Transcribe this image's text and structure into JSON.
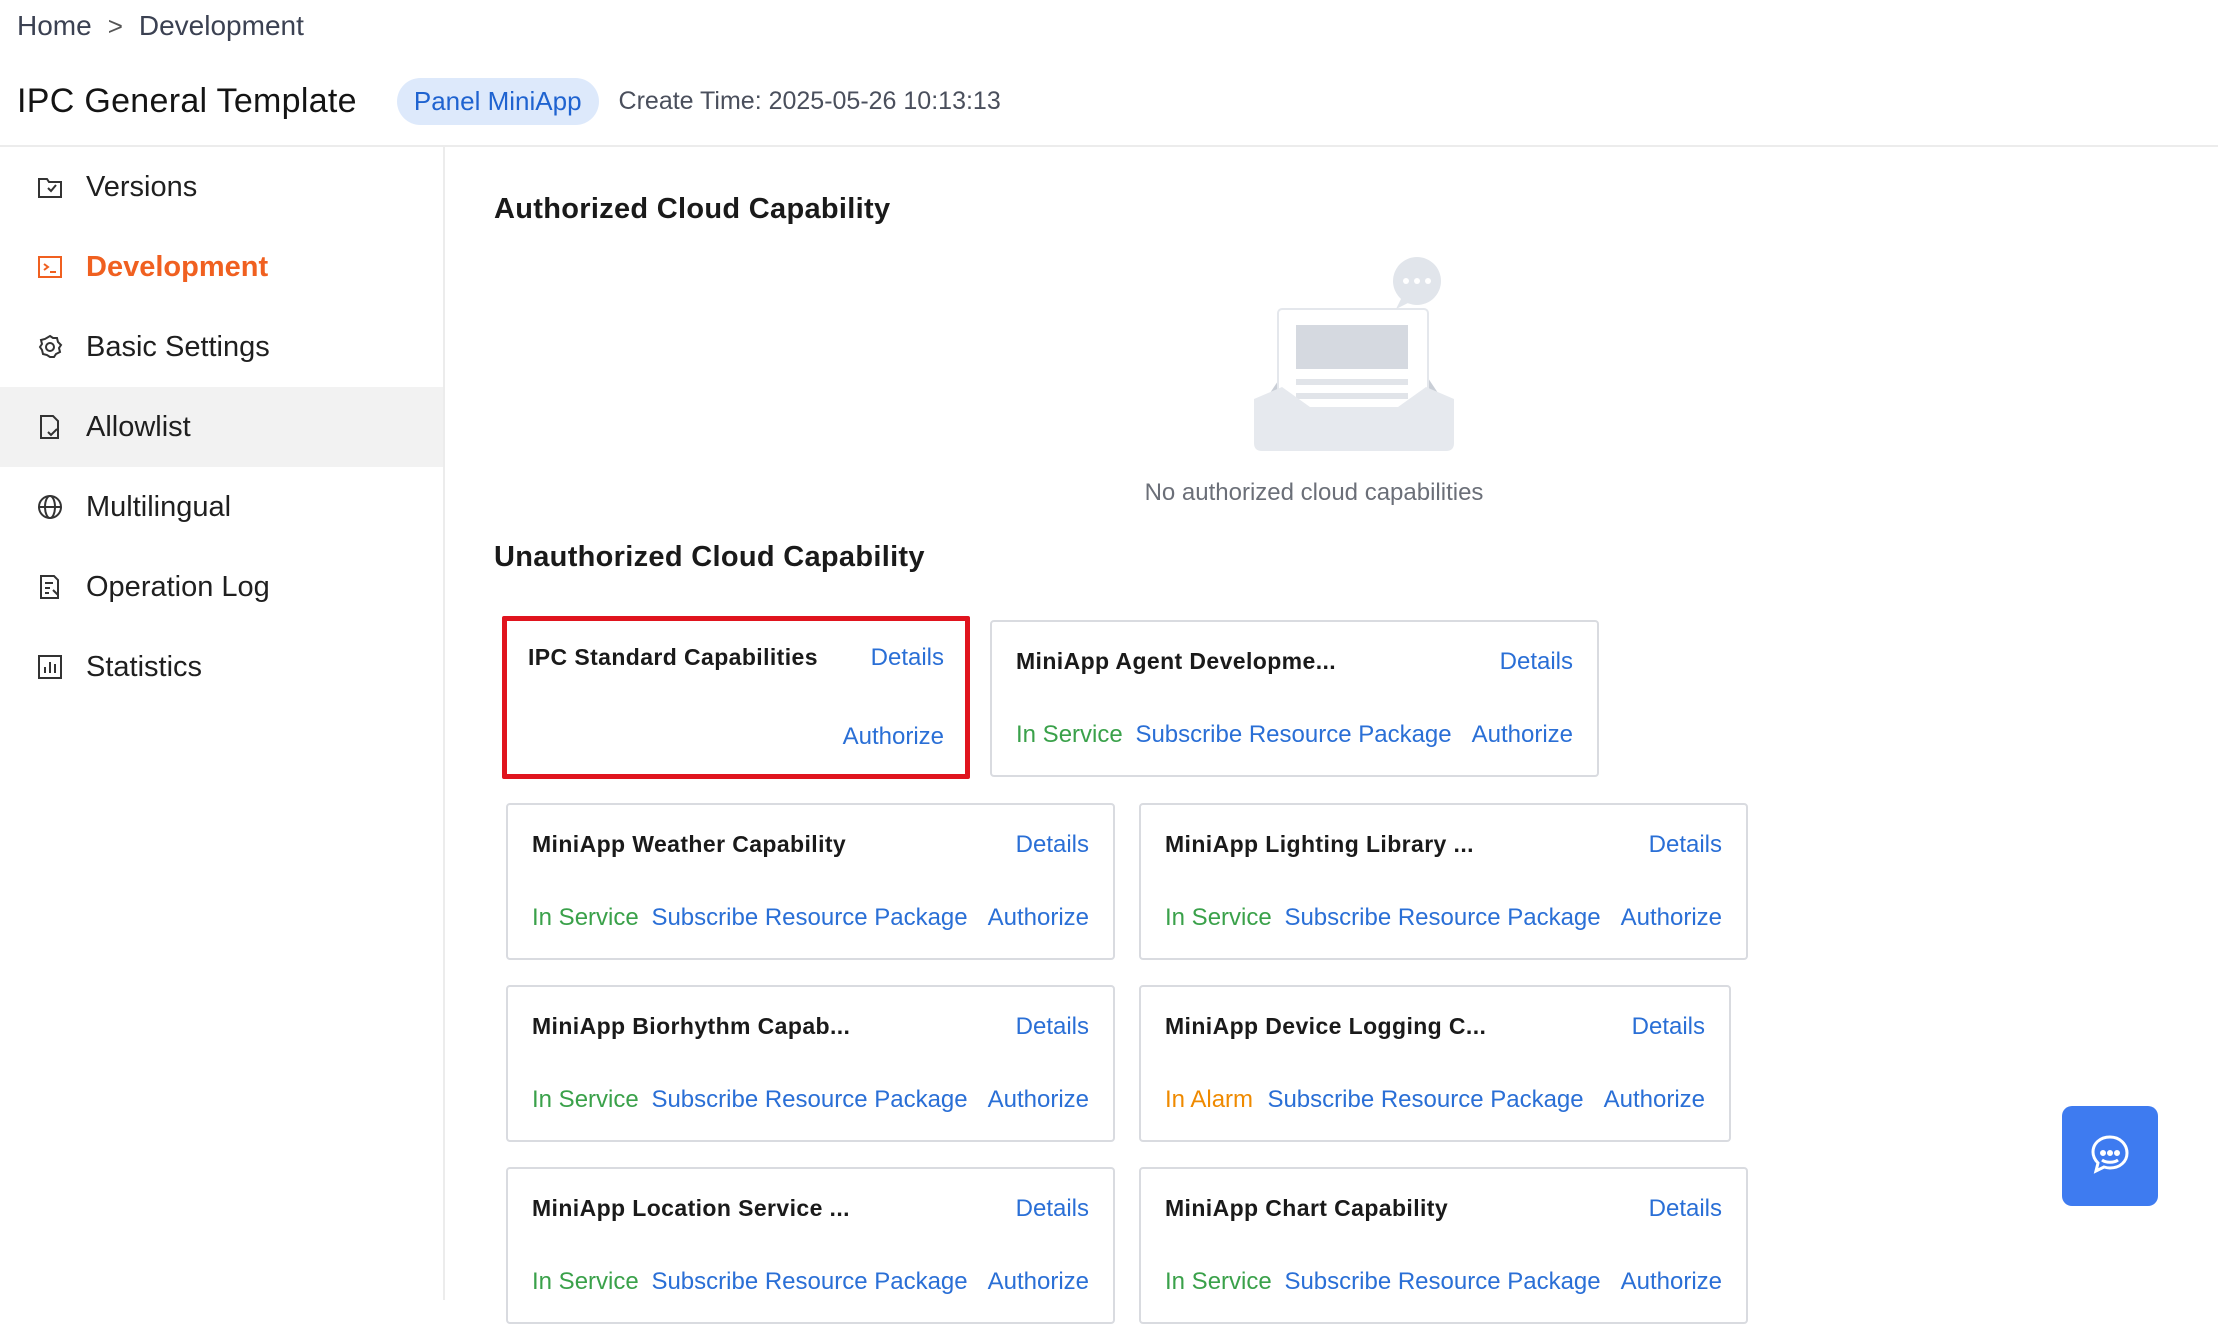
{
  "breadcrumb": {
    "home": "Home",
    "separator": ">",
    "current": "Development"
  },
  "header": {
    "title": "IPC General Template",
    "tag": "Panel MiniApp",
    "create_time": "Create Time: 2025-05-26 10:13:13"
  },
  "sidebar": {
    "items": [
      {
        "label": "Versions",
        "icon": "versions-icon"
      },
      {
        "label": "Development",
        "icon": "development-icon",
        "active": true
      },
      {
        "label": "Basic Settings",
        "icon": "gear-icon"
      },
      {
        "label": "Allowlist",
        "icon": "allowlist-icon",
        "hovered": true
      },
      {
        "label": "Multilingual",
        "icon": "globe-icon"
      },
      {
        "label": "Operation Log",
        "icon": "log-icon"
      },
      {
        "label": "Statistics",
        "icon": "statistics-icon"
      }
    ]
  },
  "authorized": {
    "title": "Authorized Cloud Capability",
    "empty_text": "No authorized cloud capabilities"
  },
  "unauthorized": {
    "title": "Unauthorized Cloud Capability",
    "cards": [
      {
        "name": "IPC Standard Capabilities",
        "details": "Details",
        "status": "",
        "subscribe": "",
        "authorize": "Authorize"
      },
      {
        "name": "MiniApp Agent Developme...",
        "details": "Details",
        "status": "In Service",
        "subscribe": "Subscribe Resource Package",
        "authorize": "Authorize"
      },
      {
        "name": "MiniApp Weather Capability",
        "details": "Details",
        "status": "In Service",
        "subscribe": "Subscribe Resource Package",
        "authorize": "Authorize"
      },
      {
        "name": "MiniApp Lighting Library ...",
        "details": "Details",
        "status": "In Service",
        "subscribe": "Subscribe Resource Package",
        "authorize": "Authorize"
      },
      {
        "name": "MiniApp Biorhythm Capab...",
        "details": "Details",
        "status": "In Service",
        "subscribe": "Subscribe Resource Package",
        "authorize": "Authorize"
      },
      {
        "name": "MiniApp Device Logging C...",
        "details": "Details",
        "status": "In Alarm",
        "subscribe": "Subscribe Resource Package",
        "authorize": "Authorize"
      },
      {
        "name": "MiniApp Location Service ...",
        "details": "Details",
        "status": "In Service",
        "subscribe": "Subscribe Resource Package",
        "authorize": "Authorize"
      },
      {
        "name": "MiniApp Chart Capability",
        "details": "Details",
        "status": "In Service",
        "subscribe": "Subscribe Resource Package",
        "authorize": "Authorize"
      }
    ]
  },
  "colors": {
    "accent": "#f06020",
    "link": "#2a6fd6",
    "status_ok": "#3aa14a",
    "status_alarm": "#ef8a00",
    "highlight_border": "#e0141e",
    "chat_button": "#3e7bf0"
  },
  "chat": {
    "icon": "chat-icon"
  }
}
